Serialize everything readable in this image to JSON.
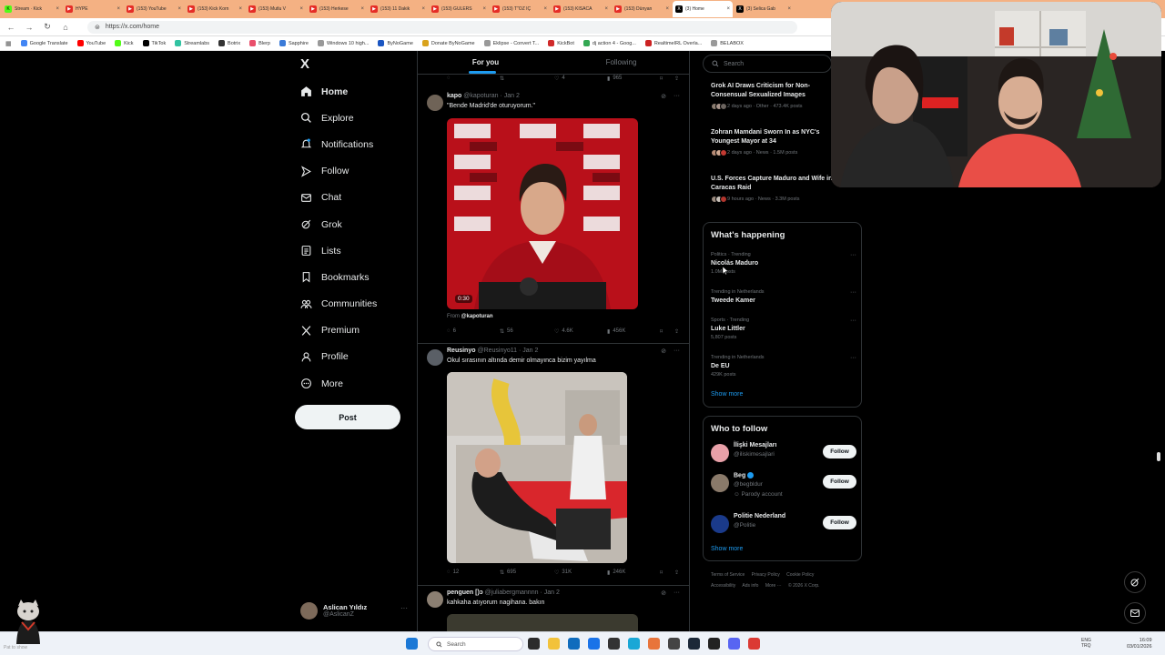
{
  "browser": {
    "tabs": [
      {
        "label": "Stream · Kick",
        "color": "#53fc18"
      },
      {
        "label": "HYPE",
        "color": "#ff0000"
      },
      {
        "label": "(153) YouTube",
        "color": "#ff0000"
      },
      {
        "label": "(153) Kick Korn",
        "color": "#ff0000"
      },
      {
        "label": "(153) Mutlu V",
        "color": "#ff0000"
      },
      {
        "label": "(153) Herkese",
        "color": "#ff0000"
      },
      {
        "label": "(153) 11 Dakik",
        "color": "#ff0000"
      },
      {
        "label": "(153) GULERS",
        "color": "#ff0000"
      },
      {
        "label": "(153) T\"OZ IÇ",
        "color": "#ff0000"
      },
      {
        "label": "(153) KISACA",
        "color": "#ff0000"
      },
      {
        "label": "(153) Dünyan",
        "color": "#ff0000"
      },
      {
        "label": "(3) Home",
        "color": "#000000",
        "active": true
      },
      {
        "label": "(3) Selica Gab",
        "color": "#000000"
      }
    ],
    "url": "https://x.com/home",
    "bookmarks": [
      "Google Translate",
      "YouTube",
      "Kick",
      "TikTok",
      "Streamlabs",
      "Botrix",
      "Blerp",
      "Sapphire",
      "Windows 10 high...",
      "ByNoGame",
      "Donate ByNoGame",
      "Eklipse - Convert T...",
      "KickBot",
      "dj action 4 - Goog...",
      "RealtimeIRL Overla...",
      "BELABOX"
    ]
  },
  "left_nav": {
    "logo": "X",
    "items": [
      {
        "label": "Home",
        "icon": "home-icon"
      },
      {
        "label": "Explore",
        "icon": "search-icon"
      },
      {
        "label": "Notifications",
        "icon": "bell-icon"
      },
      {
        "label": "Follow",
        "icon": "person-add-icon"
      },
      {
        "label": "Chat",
        "icon": "mail-icon"
      },
      {
        "label": "Grok",
        "icon": "grok-icon"
      },
      {
        "label": "Lists",
        "icon": "list-icon"
      },
      {
        "label": "Bookmarks",
        "icon": "bookmark-icon"
      },
      {
        "label": "Communities",
        "icon": "communities-icon"
      },
      {
        "label": "Premium",
        "icon": "x-icon"
      },
      {
        "label": "Profile",
        "icon": "person-icon"
      },
      {
        "label": "More",
        "icon": "more-circle-icon"
      }
    ],
    "post_label": "Post",
    "account": {
      "name": "Aslican Yıldız",
      "handle": "@AslicanZ"
    }
  },
  "timeline": {
    "tabs": [
      "For you",
      "Following"
    ],
    "top_actions": {
      "like": "4",
      "views": "965"
    },
    "tweets": [
      {
        "name": "kapo",
        "handle": "@kapoturan",
        "date": "Jan 2",
        "text": "\"Bende Madrid'de oturuyorum.\"",
        "video_duration": "0:30",
        "from_label": "From",
        "from_handle": "@kapoturan",
        "replies": "6",
        "reposts": "56",
        "likes": "4.6K",
        "views": "456K"
      },
      {
        "name": "Reusinyo",
        "handle": "@Reusinyo11",
        "date": "Jan 2",
        "text": "Okul sırasının altında demir olmayınca bizim yayılma",
        "replies": "12",
        "reposts": "695",
        "likes": "31K",
        "views": "246K"
      },
      {
        "name": "penguen [)ɔ",
        "handle": "@juliabergmannnn",
        "date": "Jan 2",
        "text": "kahkaha atıyorum nagihana. bakın"
      }
    ]
  },
  "right": {
    "search_placeholder": "Search",
    "news": [
      {
        "title": "Grok AI Draws Criticism for Non-Consensual Sexualized Images",
        "meta": "2 days ago · Other · 473.4K posts"
      },
      {
        "title": "Zohran Mamdani Sworn In as NYC's Youngest Mayor at 34",
        "meta": "2 days ago · News · 1.5M posts"
      },
      {
        "title": "U.S. Forces Capture Maduro and Wife in Caracas Raid",
        "meta": "9 hours ago · News · 3.3M posts"
      }
    ],
    "whats_happening": {
      "title": "What's happening",
      "trends": [
        {
          "category": "Politics · Trending",
          "name": "Nicolás Maduro",
          "count": "1.0M posts"
        },
        {
          "category": "Trending in Netherlands",
          "name": "Tweede Kamer",
          "count": ""
        },
        {
          "category": "Sports · Trending",
          "name": "Luke Littler",
          "count": "5,807 posts"
        },
        {
          "category": "Trending in Netherlands",
          "name": "De EU",
          "count": "429K posts"
        }
      ],
      "show_more": "Show more"
    },
    "who_to_follow": {
      "title": "Who to follow",
      "accounts": [
        {
          "name": "İlişki Mesajları",
          "handle": "@iliskimesajlari",
          "extra": "",
          "avatar_color": "#e8a0a8"
        },
        {
          "name": "Beg",
          "handle": "@begbldur",
          "extra": "Parody account",
          "avatar_color": "#8a7a6a"
        },
        {
          "name": "Politie Nederland",
          "handle": "@Politie",
          "extra": "",
          "avatar_color": "#1a3a8a"
        }
      ],
      "follow_label": "Follow",
      "show_more": "Show more"
    },
    "footer": [
      "Terms of Service",
      "Privacy Policy",
      "Cookie Policy",
      "Accessibility",
      "Ads info",
      "More ···",
      "© 2026 X Corp."
    ]
  },
  "taskbar": {
    "search_label": "Search",
    "language": "ENG",
    "region": "TRQ",
    "time": "16:09",
    "date": "03/01/2026",
    "mascot_label": "Pat to show"
  }
}
